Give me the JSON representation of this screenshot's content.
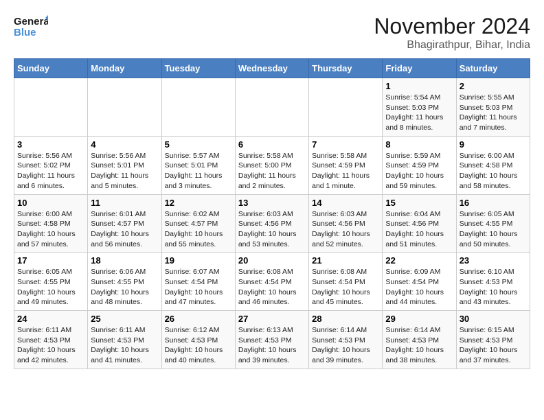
{
  "header": {
    "logo_line1": "General",
    "logo_line2": "Blue",
    "month": "November 2024",
    "location": "Bhagirathpur, Bihar, India"
  },
  "weekdays": [
    "Sunday",
    "Monday",
    "Tuesday",
    "Wednesday",
    "Thursday",
    "Friday",
    "Saturday"
  ],
  "weeks": [
    [
      {
        "day": "",
        "info": ""
      },
      {
        "day": "",
        "info": ""
      },
      {
        "day": "",
        "info": ""
      },
      {
        "day": "",
        "info": ""
      },
      {
        "day": "",
        "info": ""
      },
      {
        "day": "1",
        "info": "Sunrise: 5:54 AM\nSunset: 5:03 PM\nDaylight: 11 hours\nand 8 minutes."
      },
      {
        "day": "2",
        "info": "Sunrise: 5:55 AM\nSunset: 5:03 PM\nDaylight: 11 hours\nand 7 minutes."
      }
    ],
    [
      {
        "day": "3",
        "info": "Sunrise: 5:56 AM\nSunset: 5:02 PM\nDaylight: 11 hours\nand 6 minutes."
      },
      {
        "day": "4",
        "info": "Sunrise: 5:56 AM\nSunset: 5:01 PM\nDaylight: 11 hours\nand 5 minutes."
      },
      {
        "day": "5",
        "info": "Sunrise: 5:57 AM\nSunset: 5:01 PM\nDaylight: 11 hours\nand 3 minutes."
      },
      {
        "day": "6",
        "info": "Sunrise: 5:58 AM\nSunset: 5:00 PM\nDaylight: 11 hours\nand 2 minutes."
      },
      {
        "day": "7",
        "info": "Sunrise: 5:58 AM\nSunset: 4:59 PM\nDaylight: 11 hours\nand 1 minute."
      },
      {
        "day": "8",
        "info": "Sunrise: 5:59 AM\nSunset: 4:59 PM\nDaylight: 10 hours\nand 59 minutes."
      },
      {
        "day": "9",
        "info": "Sunrise: 6:00 AM\nSunset: 4:58 PM\nDaylight: 10 hours\nand 58 minutes."
      }
    ],
    [
      {
        "day": "10",
        "info": "Sunrise: 6:00 AM\nSunset: 4:58 PM\nDaylight: 10 hours\nand 57 minutes."
      },
      {
        "day": "11",
        "info": "Sunrise: 6:01 AM\nSunset: 4:57 PM\nDaylight: 10 hours\nand 56 minutes."
      },
      {
        "day": "12",
        "info": "Sunrise: 6:02 AM\nSunset: 4:57 PM\nDaylight: 10 hours\nand 55 minutes."
      },
      {
        "day": "13",
        "info": "Sunrise: 6:03 AM\nSunset: 4:56 PM\nDaylight: 10 hours\nand 53 minutes."
      },
      {
        "day": "14",
        "info": "Sunrise: 6:03 AM\nSunset: 4:56 PM\nDaylight: 10 hours\nand 52 minutes."
      },
      {
        "day": "15",
        "info": "Sunrise: 6:04 AM\nSunset: 4:56 PM\nDaylight: 10 hours\nand 51 minutes."
      },
      {
        "day": "16",
        "info": "Sunrise: 6:05 AM\nSunset: 4:55 PM\nDaylight: 10 hours\nand 50 minutes."
      }
    ],
    [
      {
        "day": "17",
        "info": "Sunrise: 6:05 AM\nSunset: 4:55 PM\nDaylight: 10 hours\nand 49 minutes."
      },
      {
        "day": "18",
        "info": "Sunrise: 6:06 AM\nSunset: 4:55 PM\nDaylight: 10 hours\nand 48 minutes."
      },
      {
        "day": "19",
        "info": "Sunrise: 6:07 AM\nSunset: 4:54 PM\nDaylight: 10 hours\nand 47 minutes."
      },
      {
        "day": "20",
        "info": "Sunrise: 6:08 AM\nSunset: 4:54 PM\nDaylight: 10 hours\nand 46 minutes."
      },
      {
        "day": "21",
        "info": "Sunrise: 6:08 AM\nSunset: 4:54 PM\nDaylight: 10 hours\nand 45 minutes."
      },
      {
        "day": "22",
        "info": "Sunrise: 6:09 AM\nSunset: 4:54 PM\nDaylight: 10 hours\nand 44 minutes."
      },
      {
        "day": "23",
        "info": "Sunrise: 6:10 AM\nSunset: 4:53 PM\nDaylight: 10 hours\nand 43 minutes."
      }
    ],
    [
      {
        "day": "24",
        "info": "Sunrise: 6:11 AM\nSunset: 4:53 PM\nDaylight: 10 hours\nand 42 minutes."
      },
      {
        "day": "25",
        "info": "Sunrise: 6:11 AM\nSunset: 4:53 PM\nDaylight: 10 hours\nand 41 minutes."
      },
      {
        "day": "26",
        "info": "Sunrise: 6:12 AM\nSunset: 4:53 PM\nDaylight: 10 hours\nand 40 minutes."
      },
      {
        "day": "27",
        "info": "Sunrise: 6:13 AM\nSunset: 4:53 PM\nDaylight: 10 hours\nand 39 minutes."
      },
      {
        "day": "28",
        "info": "Sunrise: 6:14 AM\nSunset: 4:53 PM\nDaylight: 10 hours\nand 39 minutes."
      },
      {
        "day": "29",
        "info": "Sunrise: 6:14 AM\nSunset: 4:53 PM\nDaylight: 10 hours\nand 38 minutes."
      },
      {
        "day": "30",
        "info": "Sunrise: 6:15 AM\nSunset: 4:53 PM\nDaylight: 10 hours\nand 37 minutes."
      }
    ]
  ]
}
